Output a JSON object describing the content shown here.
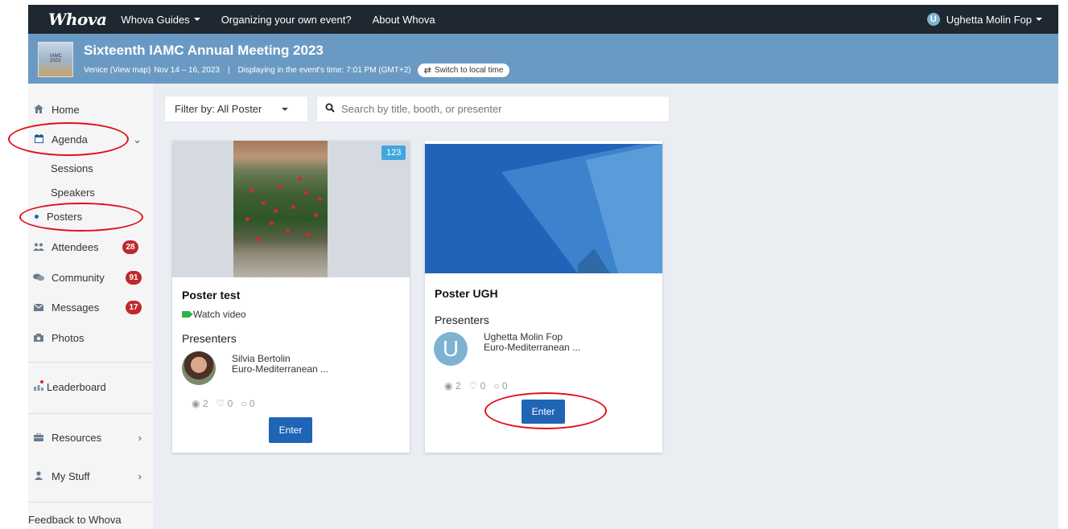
{
  "topnav": {
    "logo": "Whova",
    "links": [
      "Whova Guides",
      "Organizing your own event?",
      "About Whova"
    ],
    "user_initial": "U",
    "user_name": "Ughetta Molin Fop"
  },
  "event": {
    "thumb_text": "IAMC 2023",
    "title": "Sixteenth IAMC Annual Meeting 2023",
    "location": "Venice (View map)",
    "dates": "Nov 14 – 16, 2023",
    "separator": "|",
    "time_info": "Displaying in the event's time: 7:01 PM (GMT+2)",
    "switch_label": "Switch to local time"
  },
  "sidebar": {
    "home": "Home",
    "agenda": "Agenda",
    "sessions": "Sessions",
    "speakers": "Speakers",
    "posters": "Posters",
    "attendees": "Attendees",
    "attendees_count": "28",
    "community": "Community",
    "community_count": "91",
    "messages": "Messages",
    "messages_count": "17",
    "photos": "Photos",
    "leaderboard": "Leaderboard",
    "resources": "Resources",
    "my_stuff": "My Stuff",
    "feedback": "Feedback to Whova"
  },
  "filters": {
    "filter_label": "Filter by: All Poster",
    "search_placeholder": "Search by title, booth, or presenter"
  },
  "posters": [
    {
      "badge": "123",
      "title": "Poster test",
      "watch_label": "Watch video",
      "presenters_label": "Presenters",
      "presenter_name": "Silvia Bertolin",
      "presenter_org": "Euro-Mediterranean ...",
      "views": "2",
      "likes": "0",
      "comments": "0",
      "enter_label": "Enter"
    },
    {
      "title": "Poster UGH",
      "presenters_label": "Presenters",
      "presenter_initial": "U",
      "presenter_name": "Ughetta Molin Fop",
      "presenter_org": "Euro-Mediterranean ...",
      "views": "2",
      "likes": "0",
      "comments": "0",
      "enter_label": "Enter"
    }
  ],
  "colors": {
    "topnav_bg": "#1f2730",
    "banner_bg": "#6a9ac3",
    "badge_red": "#c0282d",
    "button_blue": "#1f64b5",
    "annotation_red": "#e0101a"
  }
}
